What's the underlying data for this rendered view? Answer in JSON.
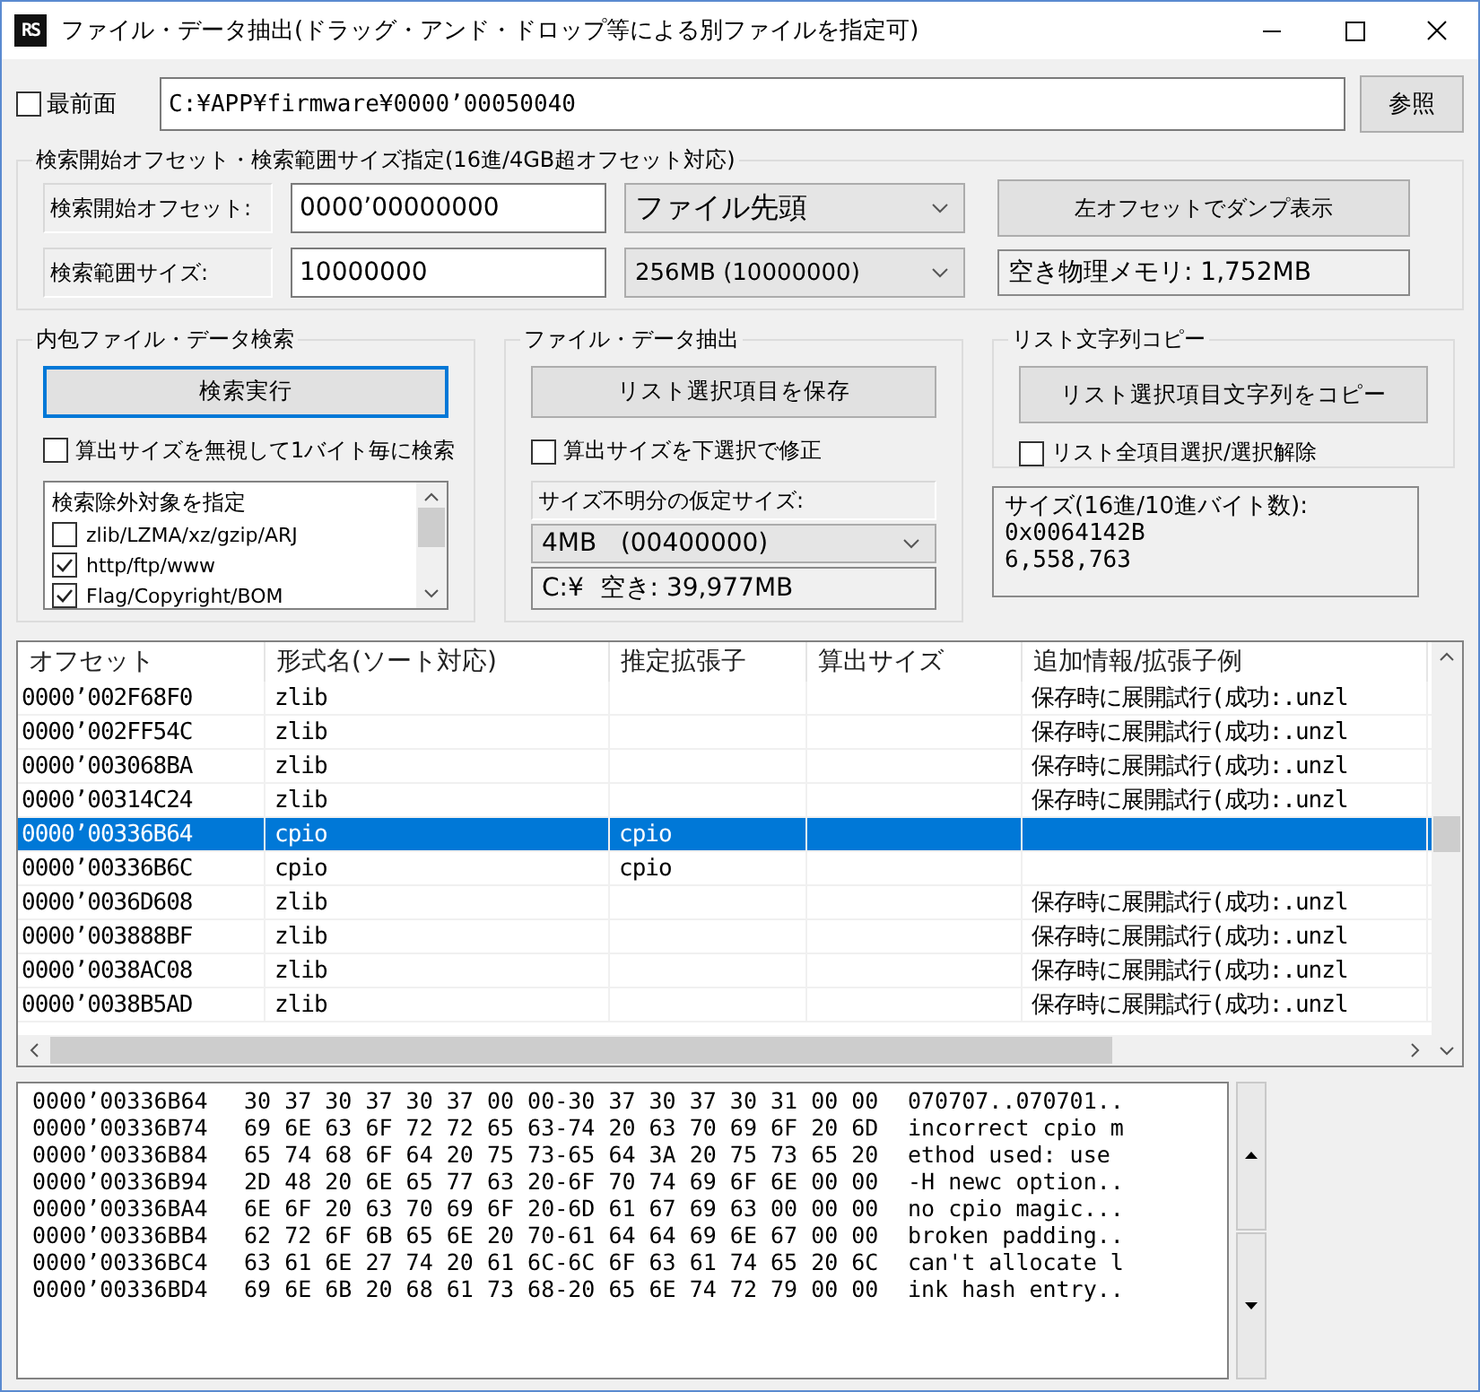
{
  "window": {
    "icon_text": "RS",
    "title": "ファイル・データ抽出(ドラッグ・アンド・ドロップ等による別ファイルを指定可)"
  },
  "top": {
    "topmost": {
      "label": "最前面",
      "checked": false
    },
    "path": "C:¥APP¥firmware¥0000’00050040",
    "browse_button": "参照"
  },
  "range": {
    "title": "検索開始オフセット・検索範囲サイズ指定(16進/4GB超オフセット対応)",
    "rows": [
      {
        "label": "検索開始オフセット:",
        "value": "0000’00000000",
        "dropdown": "ファイル先頭"
      },
      {
        "label": "検索範囲サイズ:",
        "value": "10000000",
        "dropdown": "256MB (10000000)"
      }
    ],
    "dump_button": "左オフセットでダンプ表示",
    "memory": "空き物理メモリ: 1,752MB"
  },
  "search": {
    "title": "内包ファイル・データ検索",
    "button": {
      "label": "検索実行",
      "focused": true
    },
    "option": {
      "label": "算出サイズを無視して1バイト毎に検索",
      "checked": false
    },
    "exclusions": {
      "header": "検索除外対象を指定",
      "items": [
        {
          "label": "zlib/LZMA/xz/gzip/ARJ",
          "checked": false
        },
        {
          "label": "http/ftp/www",
          "checked": true
        },
        {
          "label": "Flag/Copyright/BOM",
          "checked": true
        }
      ]
    }
  },
  "extract": {
    "title": "ファイル・データ抽出",
    "button": "リスト選択項目を保存",
    "option": {
      "label": "算出サイズを下選択で修正",
      "checked": false
    },
    "size_label": "サイズ不明分の仮定サイズ:",
    "size_dropdown": "4MB   (00400000)",
    "free_space": "C:¥  空き: 39,977MB"
  },
  "copy": {
    "title": "リスト文字列コピー",
    "button": "リスト選択項目文字列をコピー",
    "option": {
      "label": "リスト全項目選択/選択解除",
      "checked": false
    },
    "size_info": [
      "サイズ(16進/10進バイト数):",
      "0x0064142B",
      "6,558,763"
    ]
  },
  "table": {
    "columns": [
      "オフセット",
      "形式名(ソート対応)",
      "推定拡張子",
      "算出サイズ",
      "追加情報/拡張子例"
    ],
    "rows": [
      {
        "cells": [
          "0000’002F68F0",
          "zlib",
          "",
          "",
          "保存時に展開試行(成功:.unzl"
        ],
        "selected": false
      },
      {
        "cells": [
          "0000’002FF54C",
          "zlib",
          "",
          "",
          "保存時に展開試行(成功:.unzl"
        ],
        "selected": false
      },
      {
        "cells": [
          "0000’003068BA",
          "zlib",
          "",
          "",
          "保存時に展開試行(成功:.unzl"
        ],
        "selected": false
      },
      {
        "cells": [
          "0000’00314C24",
          "zlib",
          "",
          "",
          "保存時に展開試行(成功:.unzl"
        ],
        "selected": false
      },
      {
        "cells": [
          "0000’00336B64",
          "cpio",
          "cpio",
          "",
          ""
        ],
        "selected": true
      },
      {
        "cells": [
          "0000’00336B6C",
          "cpio",
          "cpio",
          "",
          ""
        ],
        "selected": false
      },
      {
        "cells": [
          "0000’0036D608",
          "zlib",
          "",
          "",
          "保存時に展開試行(成功:.unzl"
        ],
        "selected": false
      },
      {
        "cells": [
          "0000’003888BF",
          "zlib",
          "",
          "",
          "保存時に展開試行(成功:.unzl"
        ],
        "selected": false
      },
      {
        "cells": [
          "0000’0038AC08",
          "zlib",
          "",
          "",
          "保存時に展開試行(成功:.unzl"
        ],
        "selected": false
      },
      {
        "cells": [
          "0000’0038B5AD",
          "zlib",
          "",
          "",
          "保存時に展開試行(成功:.unzl"
        ],
        "selected": false
      }
    ]
  },
  "hexdump": [
    {
      "offset": "0000’00336B64",
      "hex": "30 37 30 37 30 37 00 00-30 37 30 37 30 31 00 00",
      "ascii": "070707..070701.."
    },
    {
      "offset": "0000’00336B74",
      "hex": "69 6E 63 6F 72 72 65 63-74 20 63 70 69 6F 20 6D",
      "ascii": "incorrect cpio m"
    },
    {
      "offset": "0000’00336B84",
      "hex": "65 74 68 6F 64 20 75 73-65 64 3A 20 75 73 65 20",
      "ascii": "ethod used: use "
    },
    {
      "offset": "0000’00336B94",
      "hex": "2D 48 20 6E 65 77 63 20-6F 70 74 69 6F 6E 00 00",
      "ascii": "-H newc option.."
    },
    {
      "offset": "0000’00336BA4",
      "hex": "6E 6F 20 63 70 69 6F 20-6D 61 67 69 63 00 00 00",
      "ascii": "no cpio magic..."
    },
    {
      "offset": "0000’00336BB4",
      "hex": "62 72 6F 6B 65 6E 20 70-61 64 64 69 6E 67 00 00",
      "ascii": "broken padding.."
    },
    {
      "offset": "0000’00336BC4",
      "hex": "63 61 6E 27 74 20 61 6C-6C 6F 63 61 74 65 20 6C",
      "ascii": "can't allocate l"
    },
    {
      "offset": "0000’00336BD4",
      "hex": "69 6E 6B 20 68 61 73 68-20 65 6E 74 72 79 00 00",
      "ascii": "ink hash entry.."
    }
  ]
}
